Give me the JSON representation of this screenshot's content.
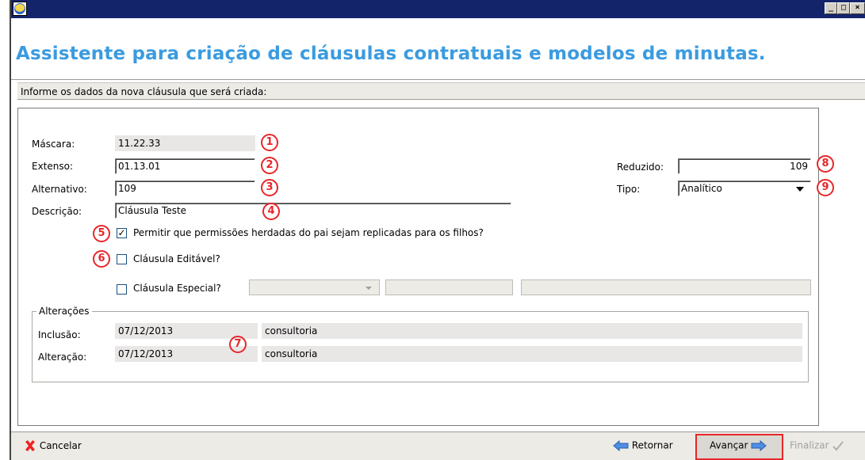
{
  "window": {
    "controls": [
      "_",
      "□",
      "×"
    ]
  },
  "header": {
    "title": "Assistente para criação de cláusulas contratuais e modelos de minutas."
  },
  "subheader": {
    "text": "Informe os dados da nova cláusula que será criada:"
  },
  "form": {
    "mascara": {
      "label": "Máscara:",
      "value": "11.22.33"
    },
    "extenso": {
      "label": "Extenso:",
      "value": "01.13.01"
    },
    "alternativo": {
      "label": "Alternativo:",
      "value": "109"
    },
    "descricao": {
      "label": "Descrição:",
      "value": "Cláusula Teste"
    },
    "reduzido": {
      "label": "Reduzido:",
      "value": "109"
    },
    "tipo": {
      "label": "Tipo:",
      "value": "Analítico"
    },
    "permitir": {
      "label": "Permitir que permissões herdadas do pai sejam replicadas para os filhos?",
      "checked": true,
      "mark": "✓"
    },
    "editavel": {
      "label": "Cláusula Editável?",
      "checked": false
    },
    "especial": {
      "label": "Cláusula Especial?",
      "checked": false
    }
  },
  "alteracoes": {
    "legend": "Alterações",
    "inclusao": {
      "label": "Inclusão:",
      "date": "07/12/2013",
      "user": "consultoria"
    },
    "alteracao": {
      "label": "Alteração:",
      "date": "07/12/2013",
      "user": "consultoria"
    }
  },
  "markers": [
    "1",
    "2",
    "3",
    "4",
    "5",
    "6",
    "7",
    "8",
    "9"
  ],
  "footer": {
    "cancelar": "Cancelar",
    "retornar": "Retornar",
    "avancar": "Avançar",
    "finalizar": "Finalizar"
  },
  "colors": {
    "title_blue": "#3a9be0",
    "titlebar": "#14246a",
    "marker_red": "#e8262a",
    "field_readonly": "#e9e6e6"
  }
}
